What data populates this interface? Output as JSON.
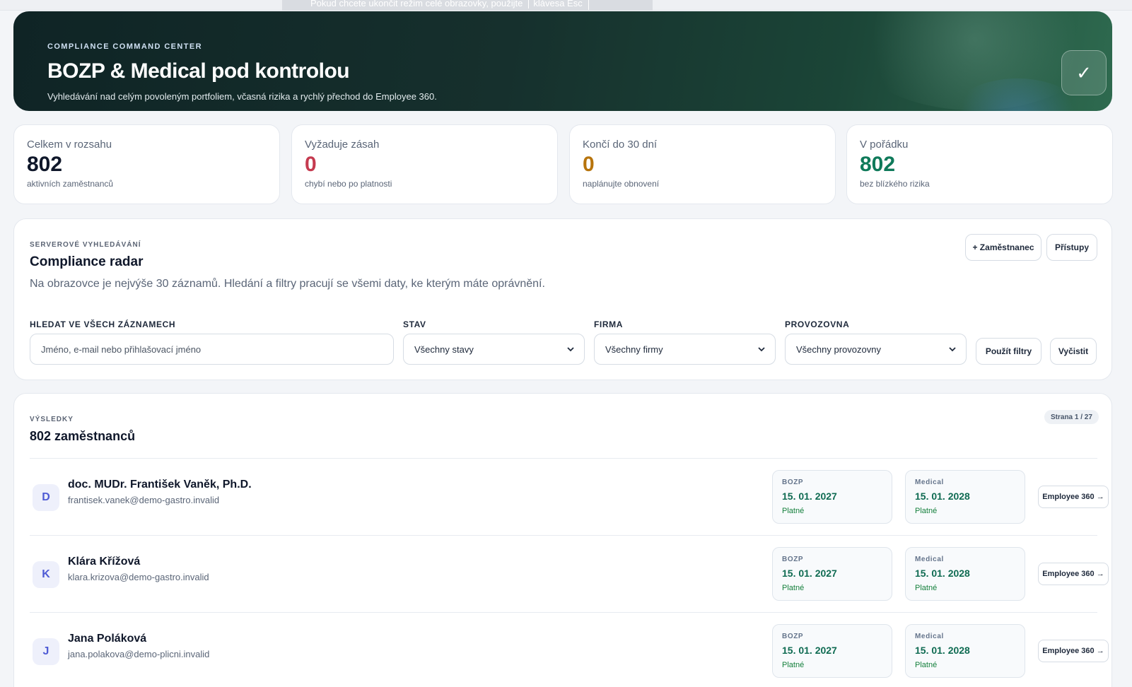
{
  "fullscreen_hint": {
    "text": "Pokud chcete ukončit režim celé obrazovky, použijte",
    "key": "klávesa Esc"
  },
  "hero": {
    "kicker": "COMPLIANCE COMMAND CENTER",
    "title": "BOZP & Medical pod kontrolou",
    "subtitle": "Vyhledávání nad celým povoleným portfoliem, včasná rizika a rychlý přechod do Employee 360.",
    "check_icon": "check-icon",
    "check_glyph": "✓"
  },
  "stats": [
    {
      "label": "Celkem v rozsahu",
      "value": "802",
      "note": "aktivních zaměstnanců",
      "color": "#0f172a"
    },
    {
      "label": "Vyžaduje zásah",
      "value": "0",
      "note": "chybí nebo po platnosti",
      "color": "#c53a4f"
    },
    {
      "label": "Končí do 30 dní",
      "value": "0",
      "note": "naplánujte obnovení",
      "color": "#b7740d"
    },
    {
      "label": "V pořádku",
      "value": "802",
      "note": "bez blízkého rizika",
      "color": "#0f7a5a"
    }
  ],
  "search": {
    "kicker": "SERVEROVÉ VYHLEDÁVÁNÍ",
    "title": "Compliance radar",
    "description": "Na obrazovce je nejvýše 30 záznamů. Hledání a filtry pracují se všemi daty, ke kterým máte oprávnění.",
    "add_employee_label": "+ Zaměstnanec",
    "access_label": "Přístupy",
    "query_label": "HLEDAT VE VŠECH ZÁZNAMECH",
    "query_placeholder": "Jméno, e-mail nebo přihlašovací jméno",
    "status_label": "STAV",
    "status_value": "Všechny stavy",
    "company_label": "FIRMA",
    "company_value": "Všechny firmy",
    "site_label": "PROVOZOVNA",
    "site_value": "Všechny provozovny",
    "apply_label": "Použít filtry",
    "clear_label": "Vyčistit"
  },
  "results": {
    "kicker": "VÝSLEDKY",
    "title": "802 zaměstnanců",
    "page_badge": "Strana 1 / 27",
    "open_label": "Employee 360 →",
    "employees": [
      {
        "initial": "D",
        "name": "doc. MUDr. František Vaněk, Ph.D.",
        "email": "frantisek.vanek@demo-gastro.invalid",
        "bozp": {
          "kind": "BOZP",
          "date": "15. 01. 2027",
          "status": "Platné"
        },
        "medical": {
          "kind": "Medical",
          "date": "15. 01. 2028",
          "status": "Platné"
        }
      },
      {
        "initial": "K",
        "name": "Klára Křížová",
        "email": "klara.krizova@demo-gastro.invalid",
        "bozp": {
          "kind": "BOZP",
          "date": "15. 01. 2027",
          "status": "Platné"
        },
        "medical": {
          "kind": "Medical",
          "date": "15. 01. 2028",
          "status": "Platné"
        }
      },
      {
        "initial": "J",
        "name": "Jana Poláková",
        "email": "jana.polakova@demo-plicni.invalid",
        "bozp": {
          "kind": "BOZP",
          "date": "15. 01. 2027",
          "status": "Platné"
        },
        "medical": {
          "kind": "Medical",
          "date": "15. 01. 2028",
          "status": "Platné"
        }
      }
    ]
  }
}
